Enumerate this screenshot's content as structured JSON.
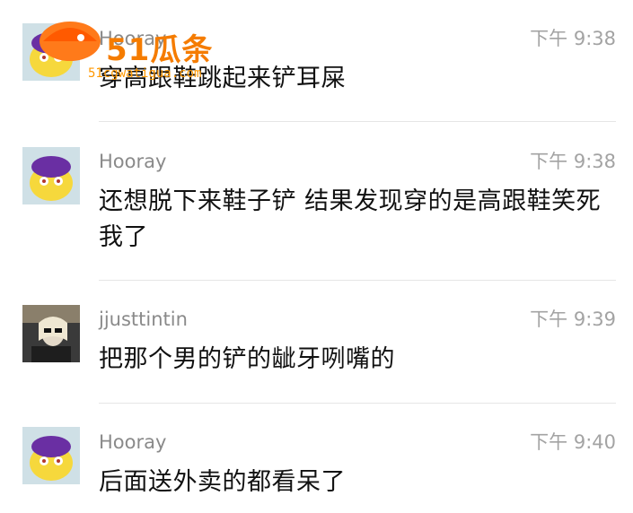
{
  "messages": [
    {
      "name": "Hooray",
      "time": "下午 9:38",
      "text": "穿高跟鞋跳起来铲耳屎"
    },
    {
      "name": "Hooray",
      "time": "下午 9:38",
      "text": "还想脱下来鞋子铲 结果发现穿的是高跟鞋笑死我了"
    },
    {
      "name": "jjusttintin",
      "time": "下午 9:39",
      "text": "把那个男的铲的龇牙咧嘴的"
    },
    {
      "name": "Hooray",
      "time": "下午 9:40",
      "text": "后面送外卖的都看呆了"
    }
  ],
  "watermark": {
    "brand": "51瓜条",
    "url": "51cgwatigua.com"
  },
  "colors": {
    "accent": "#f57c00",
    "name": "#8a8a8a",
    "time": "#a3a3a3"
  }
}
